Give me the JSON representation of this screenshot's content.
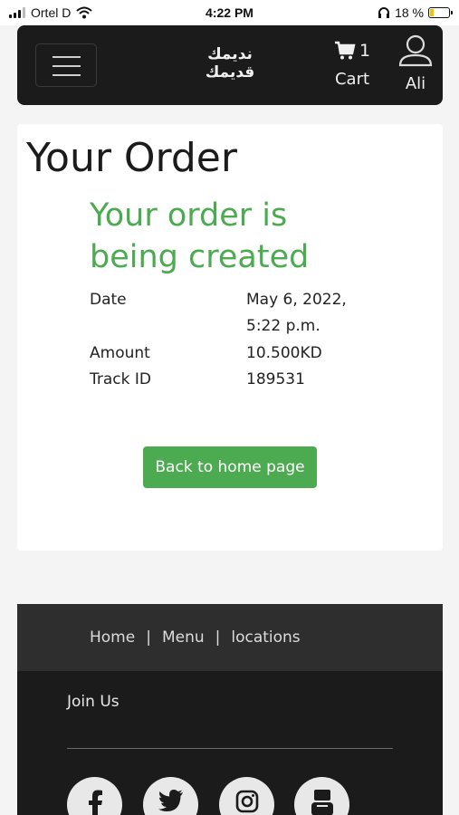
{
  "status_bar": {
    "carrier": "Ortel D",
    "time": "4:22 PM",
    "battery_percent": "18 %"
  },
  "header": {
    "logo_line1": "نديمك",
    "logo_line2": "قديمك",
    "cart_count": "1",
    "cart_label": "Cart",
    "user_label": "Ali"
  },
  "order": {
    "title": "Your Order",
    "status_message": "Your order is being created",
    "date_label": "Date",
    "date_value": "May 6, 2022, 5:22 p.m.",
    "amount_label": "Amount",
    "amount_value": "10.500KD",
    "track_label": "Track ID",
    "track_value": "189531",
    "home_button": "Back to home page"
  },
  "footer": {
    "nav": [
      "Home",
      "Menu",
      "locations"
    ],
    "separator": "|",
    "join_label": "Join Us",
    "social": [
      "facebook-icon",
      "twitter-icon",
      "instagram-icon",
      "youtube-icon"
    ]
  },
  "colors": {
    "accent_green": "#4caa50",
    "header_dark": "#1b1b1b",
    "footer_nav": "#2e2e2e"
  }
}
